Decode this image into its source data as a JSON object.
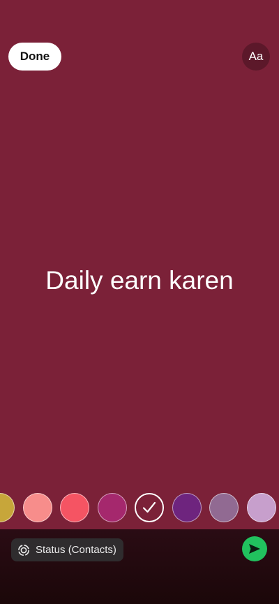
{
  "theme": {
    "background": "#7b2138",
    "bottom_bar": "#1e080b",
    "send_green": "#21c15e"
  },
  "header": {
    "done_label": "Done",
    "font_toggle_label": "Aa"
  },
  "status": {
    "text": "Daily earn karen"
  },
  "palette": {
    "colors": [
      "#c7a63a",
      "#f78d8b",
      "#f55463",
      "#a5286d",
      "#7b2138",
      "#6e247e",
      "#916a92",
      "#c79fcc"
    ],
    "selected_index": 4,
    "selected_icon": "check-icon"
  },
  "footer": {
    "audience_icon": "status-ring-icon",
    "audience_label": "Status (Contacts)",
    "send_icon": "send-arrow-icon"
  }
}
